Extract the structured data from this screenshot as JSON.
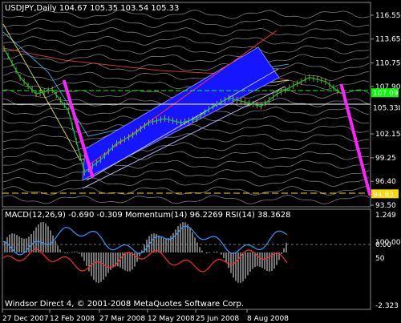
{
  "header": {
    "main_caption": "USDJPY,Daily  104.67 105.35 103.54 105.33",
    "indicator_caption": "MACD(12,26,9) -0.690 -0.309  Momentum(14) 96.2269  RSI(14) 38.3628",
    "copyright": "Windsor Direct 4, © 2001-2008 MetaQuotes Software Corp."
  },
  "chart_data": [
    {
      "type": "line",
      "title": "USDJPY,Daily",
      "ohlc": {
        "open": 104.67,
        "high": 105.35,
        "low": 103.54,
        "close": 105.33
      },
      "ylim": [
        93.5,
        118.0
      ],
      "y_ticks": [
        "116.55",
        "113.65",
        "110.75",
        "107.90",
        "105.33",
        "102.15",
        "99.25",
        "96.40",
        "93.50"
      ],
      "x_ticks": [
        "27 Dec 2007",
        "12 Feb 2008",
        "27 Mar 2008",
        "12 May 2008",
        "25 Jun 2008",
        "8 Aug 2008"
      ],
      "price_labels": [
        {
          "value": "107.09",
          "color": "#00ff00"
        },
        {
          "value": "105.33",
          "color": "#ffffff"
        },
        {
          "value": "94.83",
          "color": "#ffd700"
        }
      ],
      "series": [
        {
          "color": "#00cc44",
          "x": [
            0,
            8,
            16,
            24,
            32,
            40,
            48,
            56,
            64,
            72,
            80,
            88,
            96,
            104,
            112,
            120,
            128,
            136,
            144,
            152,
            160,
            168
          ],
          "values": [
            112.5,
            109.0,
            107.0,
            107.5,
            105.0,
            97.5,
            99.0,
            101.0,
            102.0,
            103.5,
            104.0,
            103.5,
            104.0,
            105.5,
            106.5,
            106.0,
            105.5,
            107.0,
            108.0,
            109.0,
            108.5,
            107.0
          ]
        }
      ],
      "projection_lines": [
        {
          "color": "#ff22ff",
          "x": [
            30,
            44
          ],
          "values": [
            108.5,
            97.0
          ]
        },
        {
          "color": "#ff22ff",
          "x": [
            168,
            182
          ],
          "values": [
            108.0,
            94.83
          ]
        }
      ]
    },
    {
      "type": "line",
      "title": "MACD(12,26,9)",
      "macd": -0.69,
      "signal": -0.309,
      "momentum": 96.2269,
      "rsi": 38.3628,
      "y_ticks": [
        "1.249",
        "100.00",
        "0.00",
        "50",
        "-2.323"
      ]
    }
  ]
}
